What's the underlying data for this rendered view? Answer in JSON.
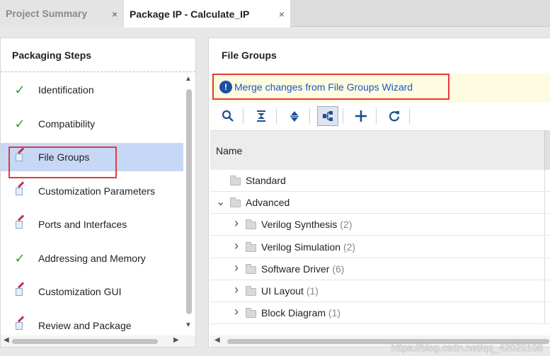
{
  "tabs": [
    {
      "label": "Project Summary",
      "close": "×"
    },
    {
      "label": "Package IP - Calculate_IP",
      "close": "×"
    }
  ],
  "left_panel": {
    "title": "Packaging Steps",
    "steps": [
      {
        "label": "Identification",
        "status": "check"
      },
      {
        "label": "Compatibility",
        "status": "check"
      },
      {
        "label": "File Groups",
        "status": "edit"
      },
      {
        "label": "Customization Parameters",
        "status": "edit"
      },
      {
        "label": "Ports and Interfaces",
        "status": "edit"
      },
      {
        "label": "Addressing and Memory",
        "status": "check"
      },
      {
        "label": "Customization GUI",
        "status": "edit"
      },
      {
        "label": "Review and Package",
        "status": "edit"
      }
    ]
  },
  "right_panel": {
    "title": "File Groups",
    "banner": {
      "icon": "info-icon",
      "link": "Merge changes from File Groups Wizard"
    },
    "toolbar": [
      "search-icon",
      "collapse-all-icon",
      "expand-all-icon",
      "hierarchy-icon",
      "add-icon",
      "refresh-icon"
    ],
    "column_header": "Name",
    "rows": [
      {
        "name": "Standard",
        "count": "",
        "level": 0,
        "expander": ""
      },
      {
        "name": "Advanced",
        "count": "",
        "level": 0,
        "expander": "open"
      },
      {
        "name": "Verilog Synthesis",
        "count": "(2)",
        "level": 1,
        "expander": "closed"
      },
      {
        "name": "Verilog Simulation",
        "count": "(2)",
        "level": 1,
        "expander": "closed"
      },
      {
        "name": "Software Driver",
        "count": "(6)",
        "level": 1,
        "expander": "closed"
      },
      {
        "name": "UI Layout",
        "count": "(1)",
        "level": 1,
        "expander": "closed"
      },
      {
        "name": "Block Diagram",
        "count": "(1)",
        "level": 1,
        "expander": "closed"
      }
    ]
  },
  "watermark": "https://blog.csdn.net/qq_42025108",
  "colors": {
    "highlight": "#e23b3b",
    "selected_row": "#c6d8f5",
    "link": "#1a56c8",
    "check": "#2e9b2e",
    "banner_bg": "#fdfbe0"
  }
}
